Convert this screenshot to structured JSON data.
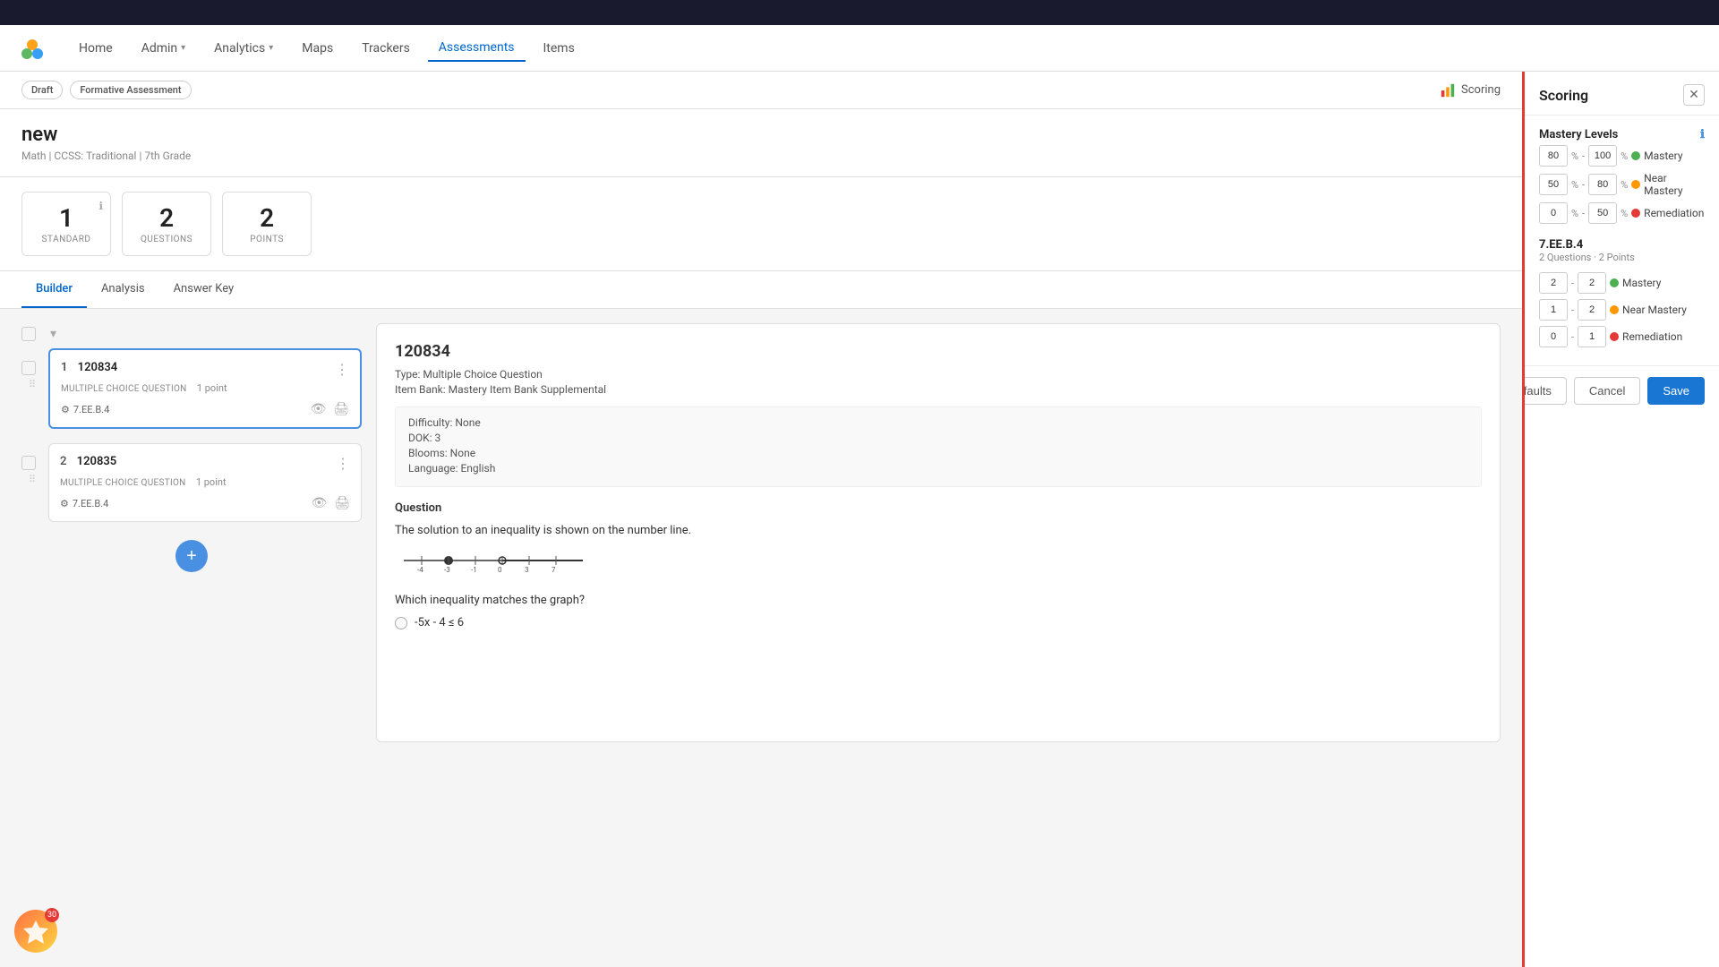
{
  "topBar": {},
  "nav": {
    "logo": "🌿",
    "items": [
      {
        "label": "Home",
        "active": false
      },
      {
        "label": "Admin",
        "hasDropdown": true,
        "active": false
      },
      {
        "label": "Analytics",
        "hasDropdown": true,
        "active": false
      },
      {
        "label": "Maps",
        "active": false
      },
      {
        "label": "Trackers",
        "active": false
      },
      {
        "label": "Assessments",
        "active": true
      },
      {
        "label": "Items",
        "active": false
      }
    ]
  },
  "subHeader": {
    "badges": [
      {
        "label": "Draft",
        "style": "draft"
      },
      {
        "label": "Formative Assessment",
        "style": "formative"
      }
    ],
    "scoringBtn": "Scoring"
  },
  "pageTitle": {
    "title": "new",
    "subtitle": "Math | CCSS: Traditional | 7th Grade"
  },
  "stats": [
    {
      "number": "1",
      "label": "STANDARD",
      "hasInfo": true
    },
    {
      "number": "2",
      "label": "QUESTIONS",
      "hasInfo": false
    },
    {
      "number": "2",
      "label": "POINTS",
      "hasInfo": false
    }
  ],
  "tabs": [
    {
      "label": "Builder",
      "active": true
    },
    {
      "label": "Analysis",
      "active": false
    },
    {
      "label": "Answer Key",
      "active": false
    }
  ],
  "questions": [
    {
      "num": "1",
      "id": "120834",
      "type": "MULTIPLE CHOICE QUESTION",
      "points": "1 point",
      "standard": "7.EE.B.4",
      "selected": true
    },
    {
      "num": "2",
      "id": "120835",
      "type": "MULTIPLE CHOICE QUESTION",
      "points": "1 point",
      "standard": "7.EE.B.4",
      "selected": false
    }
  ],
  "questionDetail": {
    "id": "120834",
    "meta": [
      {
        "label": "Type: Multiple Choice Question"
      },
      {
        "label": "Item Bank: Mastery Item Bank Supplemental"
      }
    ],
    "attrs": [
      {
        "label": "Difficulty: None"
      },
      {
        "label": "DOK: 3"
      },
      {
        "label": "Blooms: None"
      },
      {
        "label": "Language: English"
      }
    ],
    "sectionLabel": "Question",
    "questionText": "The solution to an inequality is shown on the number line.",
    "answerLabel": "Which inequality matches the graph?",
    "options": [
      {
        "text": "-5x - 4 ≤ 6"
      }
    ]
  },
  "scoring": {
    "title": "Scoring",
    "masteryTitle": "Mastery Levels",
    "levels": [
      {
        "min": "80",
        "max": "100",
        "label": "Mastery",
        "color": "green"
      },
      {
        "min": "50",
        "max": "80",
        "label": "Near Mastery",
        "color": "orange"
      },
      {
        "min": "0",
        "max": "50",
        "label": "Remediation",
        "color": "red"
      }
    ],
    "standard": {
      "id": "7.EE.B.4",
      "sub": "2 Questions · 2 Points",
      "rows": [
        {
          "val1": "2",
          "val2": "2",
          "label": "Mastery",
          "color": "green"
        },
        {
          "val1": "1",
          "val2": "2",
          "label": "Near Mastery",
          "color": "orange"
        },
        {
          "val1": "0",
          "val2": "1",
          "label": "Remediation",
          "color": "red"
        }
      ]
    },
    "footer": {
      "defaults": "Defaults",
      "cancel": "Cancel",
      "save": "Save"
    }
  },
  "addButton": "+",
  "avatar": {
    "badge": "30"
  }
}
